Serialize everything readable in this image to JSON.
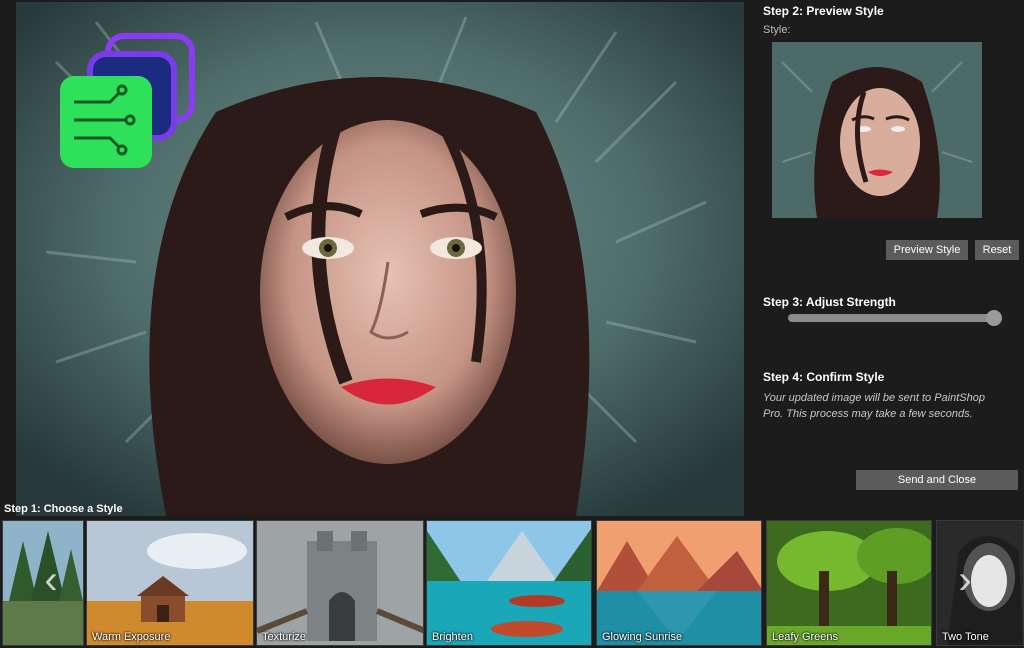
{
  "panel": {
    "step2_title": "Step 2: Preview Style",
    "style_label": "Style:",
    "preview_button": "Preview Style",
    "reset_button": "Reset",
    "step3_title": "Step 3: Adjust Strength",
    "strength": 0.98,
    "step4_title": "Step 4: Confirm Style",
    "confirm_text": "Your updated image will be sent to PaintShop Pro. This process may take a few seconds.",
    "send_button": "Send and Close"
  },
  "strip": {
    "title": "Step 1: Choose a Style",
    "prev_arrow": "‹",
    "next_arrow": "›",
    "tiles": [
      {
        "label": ""
      },
      {
        "label": "Warm Exposure"
      },
      {
        "label": "Texturize"
      },
      {
        "label": "Brighten"
      },
      {
        "label": "Glowing Sunrise"
      },
      {
        "label": "Leafy Greens"
      },
      {
        "label": "Two Tone"
      }
    ]
  },
  "colors": {
    "accent_logo_green": "#2ee05a",
    "accent_logo_purple": "#8a3cf0",
    "panel_bg": "#1c1c1c",
    "button_bg": "#5b5b5b"
  },
  "icons": {
    "logo": "app-logo-icon",
    "prev": "chevron-left-icon",
    "next": "chevron-right-icon"
  }
}
